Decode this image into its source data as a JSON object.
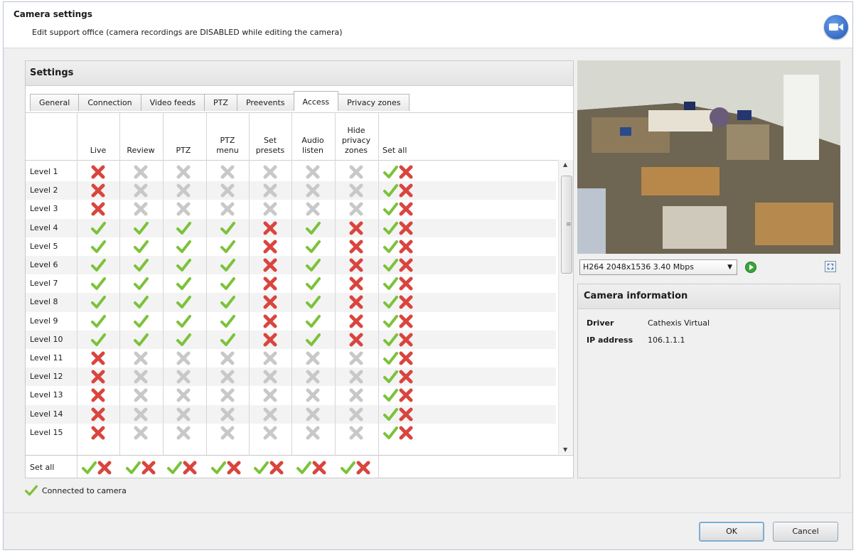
{
  "header": {
    "title": "Camera settings",
    "subtitle": "Edit support office (camera recordings are DISABLED while editing the camera)"
  },
  "settings": {
    "title": "Settings",
    "tabs": [
      "General",
      "Connection",
      "Video feeds",
      "PTZ",
      "Preevents",
      "Access",
      "Privacy zones"
    ],
    "active_tab": "Access",
    "columns": [
      [
        "Live"
      ],
      [
        "Review"
      ],
      [
        "PTZ"
      ],
      [
        "PTZ",
        "menu"
      ],
      [
        "Set",
        "presets"
      ],
      [
        "Audio",
        "listen"
      ],
      [
        "Hide",
        "privacy",
        "zones"
      ],
      [
        "Set all"
      ]
    ],
    "rows": [
      {
        "label": "Level 1",
        "cells": [
          "x",
          "g",
          "g",
          "g",
          "g",
          "g",
          "g"
        ]
      },
      {
        "label": "Level 2",
        "cells": [
          "x",
          "g",
          "g",
          "g",
          "g",
          "g",
          "g"
        ]
      },
      {
        "label": "Level 3",
        "cells": [
          "x",
          "g",
          "g",
          "g",
          "g",
          "g",
          "g"
        ]
      },
      {
        "label": "Level 4",
        "cells": [
          "c",
          "c",
          "c",
          "c",
          "x",
          "c",
          "x"
        ]
      },
      {
        "label": "Level 5",
        "cells": [
          "c",
          "c",
          "c",
          "c",
          "x",
          "c",
          "x"
        ]
      },
      {
        "label": "Level 6",
        "cells": [
          "c",
          "c",
          "c",
          "c",
          "x",
          "c",
          "x"
        ]
      },
      {
        "label": "Level 7",
        "cells": [
          "c",
          "c",
          "c",
          "c",
          "x",
          "c",
          "x"
        ]
      },
      {
        "label": "Level 8",
        "cells": [
          "c",
          "c",
          "c",
          "c",
          "x",
          "c",
          "x"
        ]
      },
      {
        "label": "Level 9",
        "cells": [
          "c",
          "c",
          "c",
          "c",
          "x",
          "c",
          "x"
        ]
      },
      {
        "label": "Level 10",
        "cells": [
          "c",
          "c",
          "c",
          "c",
          "x",
          "c",
          "x"
        ]
      },
      {
        "label": "Level 11",
        "cells": [
          "x",
          "g",
          "g",
          "g",
          "g",
          "g",
          "g"
        ]
      },
      {
        "label": "Level 12",
        "cells": [
          "x",
          "g",
          "g",
          "g",
          "g",
          "g",
          "g"
        ]
      },
      {
        "label": "Level 13",
        "cells": [
          "x",
          "g",
          "g",
          "g",
          "g",
          "g",
          "g"
        ]
      },
      {
        "label": "Level 14",
        "cells": [
          "x",
          "g",
          "g",
          "g",
          "g",
          "g",
          "g"
        ]
      },
      {
        "label": "Level 15",
        "cells": [
          "x",
          "g",
          "g",
          "g",
          "g",
          "g",
          "g"
        ]
      }
    ],
    "set_all_label": "Set all"
  },
  "status": {
    "text": "Connected to camera"
  },
  "video": {
    "stream": "H264 2048x1536 3.40 Mbps"
  },
  "camera_info": {
    "title": "Camera information",
    "driver_label": "Driver",
    "driver_value": "Cathexis Virtual",
    "ip_label": "IP address",
    "ip_value": "106.1.1.1"
  },
  "buttons": {
    "ok": "OK",
    "cancel": "Cancel"
  },
  "icons": {
    "check": "check-icon",
    "cross": "cross-icon",
    "disabled": "disabled-cross-icon"
  },
  "colors": {
    "check": "#7cc23a",
    "cross": "#d9453e",
    "disabled": "#c8c8c8"
  }
}
